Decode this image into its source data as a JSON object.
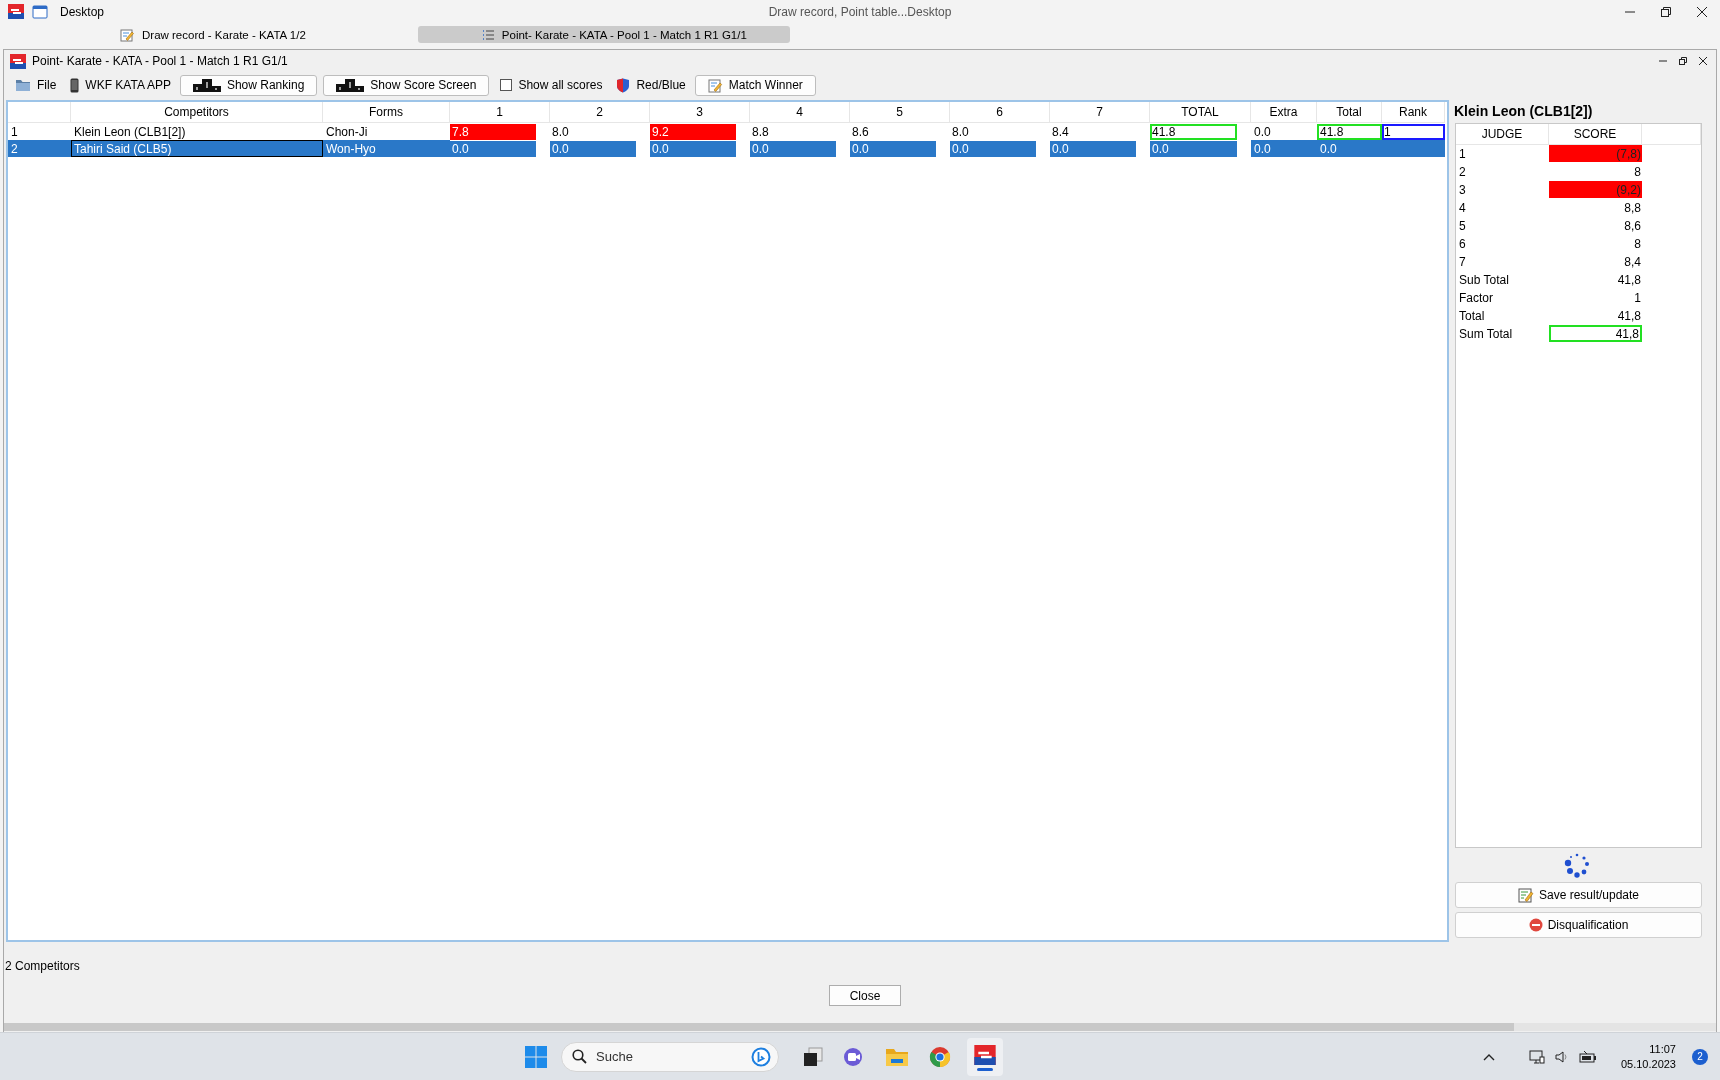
{
  "os_window": {
    "title": "Desktop",
    "caption": "Draw record, Point table...Desktop"
  },
  "doc_tabs": [
    {
      "label": "Draw record - Karate - KATA 1/2",
      "selected": false
    },
    {
      "label": "Point- Karate - KATA - Pool 1 - Match 1 R1 G1/1",
      "selected": true
    }
  ],
  "window": {
    "title": "Point- Karate - KATA - Pool 1 - Match 1 R1 G1/1"
  },
  "toolbar": [
    {
      "kind": "menu",
      "label": "File"
    },
    {
      "kind": "menu",
      "label": "WKF KATA APP"
    },
    {
      "kind": "button",
      "label": "Show Ranking"
    },
    {
      "kind": "button",
      "label": "Show Score Screen"
    },
    {
      "kind": "checkbox",
      "label": "Show all scores",
      "checked": false
    },
    {
      "kind": "menu",
      "label": "Red/Blue"
    },
    {
      "kind": "button",
      "label": "Match Winner"
    }
  ],
  "table": {
    "columns": [
      "Competitors",
      "Forms",
      "1",
      "2",
      "3",
      "4",
      "5",
      "6",
      "7",
      "TOTAL",
      "Extra",
      "Total",
      "Rank"
    ],
    "rows": [
      {
        "number": "1",
        "competitor": "Klein Leon (CLB1[2])",
        "focused": false,
        "form": "Chon-Ji",
        "scores": [
          {
            "value": "7.8",
            "discarded": true
          },
          {
            "value": "8.0",
            "discarded": false
          },
          {
            "value": "9.2",
            "discarded": true
          },
          {
            "value": "8.8",
            "discarded": false
          },
          {
            "value": "8.6",
            "discarded": false
          },
          {
            "value": "8.0",
            "discarded": false
          },
          {
            "value": "8.4",
            "discarded": false
          }
        ],
        "total": {
          "value": "41.8",
          "outlined": true
        },
        "extra": "0.0",
        "sum_total": {
          "value": "41.8",
          "outlined": true
        },
        "rank": {
          "value": "1",
          "outlined": true
        },
        "selected": false
      },
      {
        "number": "2",
        "competitor": "Tahiri Said (CLB5)",
        "focused": true,
        "form": "Won-Hyo",
        "scores": [
          {
            "value": "0.0",
            "discarded": false
          },
          {
            "value": "0.0",
            "discarded": false
          },
          {
            "value": "0.0",
            "discarded": false
          },
          {
            "value": "0.0",
            "discarded": false
          },
          {
            "value": "0.0",
            "discarded": false
          },
          {
            "value": "0.0",
            "discarded": false
          },
          {
            "value": "0.0",
            "discarded": false
          }
        ],
        "total": {
          "value": "0.0",
          "outlined": false
        },
        "extra": "0.0",
        "sum_total": {
          "value": "0.0",
          "outlined": false
        },
        "rank": {
          "outlined": false
        },
        "selected": true
      }
    ]
  },
  "side_panel": {
    "title": "Klein Leon (CLB1[2])",
    "columns": [
      "JUDGE",
      "SCORE"
    ],
    "judges": [
      {
        "label": "1",
        "score": "(7,8)",
        "discarded": true
      },
      {
        "label": "2",
        "score": "8",
        "discarded": false
      },
      {
        "label": "3",
        "score": "(9,2)",
        "discarded": true
      },
      {
        "label": "4",
        "score": "8,8",
        "discarded": false
      },
      {
        "label": "5",
        "score": "8,6",
        "discarded": false
      },
      {
        "label": "6",
        "score": "8",
        "discarded": false
      },
      {
        "label": "7",
        "score": "8,4",
        "discarded": false
      }
    ],
    "summary": [
      {
        "label": "Sub Total",
        "value": "41,8",
        "outlined": false
      },
      {
        "label": "Factor",
        "value": "1",
        "outlined": false
      },
      {
        "label": "Total",
        "value": "41,8",
        "outlined": false
      },
      {
        "label": "Sum Total",
        "value": "41,8",
        "outlined": true
      }
    ],
    "buttons": [
      {
        "kind": "save",
        "label": "Save result/update"
      },
      {
        "kind": "disqualify",
        "label": "Disqualification"
      }
    ]
  },
  "status": "2 Competitors",
  "close_button": "Close",
  "taskbar": {
    "search": {
      "placeholder": "Suche"
    },
    "time": "11:07",
    "date": "05.10.2023",
    "notifications": "2"
  }
}
